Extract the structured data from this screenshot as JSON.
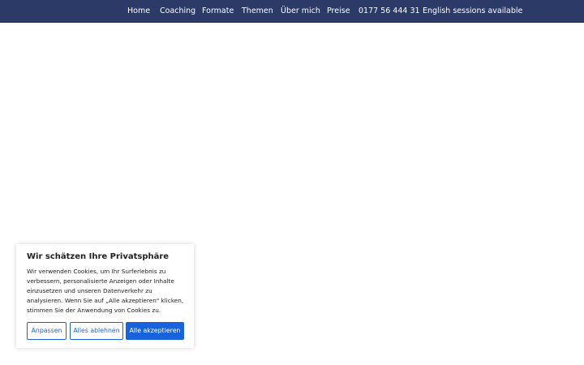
{
  "nav": {
    "items": [
      {
        "label": "Home"
      },
      {
        "label": "Coaching"
      },
      {
        "label": "Formate"
      },
      {
        "label": "Themen"
      },
      {
        "label": "Über mich"
      },
      {
        "label": "Preise"
      },
      {
        "label": "0177 56 444 31"
      },
      {
        "label": "English sessions available"
      }
    ]
  },
  "cookie": {
    "title": "Wir schätzen Ihre Privatsphäre",
    "text_lines": [
      "Wir verwenden Cookies, um Ihr Surferlebnis zu",
      "verbessern, personalisierte Anzeigen oder Inhalte",
      "einzusetzen und unseren Datenverkehr zu",
      "analysieren. Wenn Sie auf „Alle akzeptieren\" klicken,",
      "stimmen Sie der Anwendung von Cookies zu."
    ],
    "buttons": {
      "customize": "Anpassen",
      "reject": "Alles ablehnen",
      "accept": "Alle akzeptieren"
    }
  },
  "colors": {
    "nav_background": "#2b3a67",
    "accent": "#1863dc"
  }
}
